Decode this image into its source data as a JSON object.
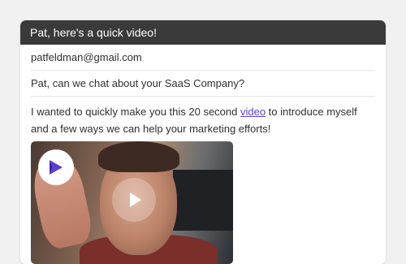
{
  "header": {
    "title": "Pat, here's a quick video!"
  },
  "email": {
    "to": "patfeldman@gmail.com",
    "subject": "Pat, can we chat about your SaaS Company?"
  },
  "message": {
    "text_before_link": "I wanted to quickly make you this 20 second ",
    "link_text": "video",
    "text_after_link": " to introduce myself and a few ways we can help your marketing efforts!"
  },
  "video": {
    "logo_icon": "brand-logo-icon",
    "play_icon": "play-icon"
  },
  "colors": {
    "header_bg": "#3a3a3a",
    "link": "#5b3fd6",
    "logo_accent": "#5b3fd6"
  }
}
